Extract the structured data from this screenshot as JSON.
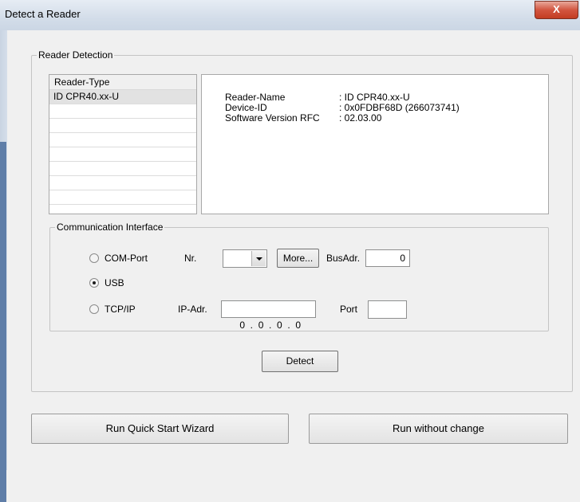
{
  "window": {
    "title": "Detect a Reader",
    "close_glyph": "X"
  },
  "reader_detection": {
    "legend": "Reader Detection",
    "list": {
      "header": "Reader-Type",
      "rows": [
        "ID CPR40.xx-U",
        "",
        "",
        "",
        "",
        "",
        "",
        ""
      ],
      "selected_index": 0
    },
    "info": [
      {
        "key": "Reader-Name",
        "value": ": ID CPR40.xx-U"
      },
      {
        "key": "Device-ID",
        "value": ": 0x0FDBF68D (266073741)"
      },
      {
        "key": "Software Version RFC",
        "value": ": 02.03.00"
      }
    ],
    "comm": {
      "legend": "Communication Interface",
      "com_port": {
        "label": "COM-Port",
        "checked": false
      },
      "nr_label": "Nr.",
      "nr_value": "",
      "more_label": "More...",
      "busadr_label": "BusAdr.",
      "busadr_value": "0",
      "usb": {
        "label": "USB",
        "checked": true
      },
      "tcpip": {
        "label": "TCP/IP",
        "checked": false
      },
      "ip_label": "IP-Adr.",
      "ip_value": "0  .  0  .  0  .  0",
      "port_label": "Port",
      "port_value": ""
    },
    "detect_label": "Detect"
  },
  "footer": {
    "quick_start_label": "Run Quick Start Wizard",
    "run_without_change_label": "Run without change"
  },
  "colors": {
    "titlebar": "#d3dde9",
    "close_button": "#c8432a",
    "dialog_bg": "#f0f0f0"
  }
}
